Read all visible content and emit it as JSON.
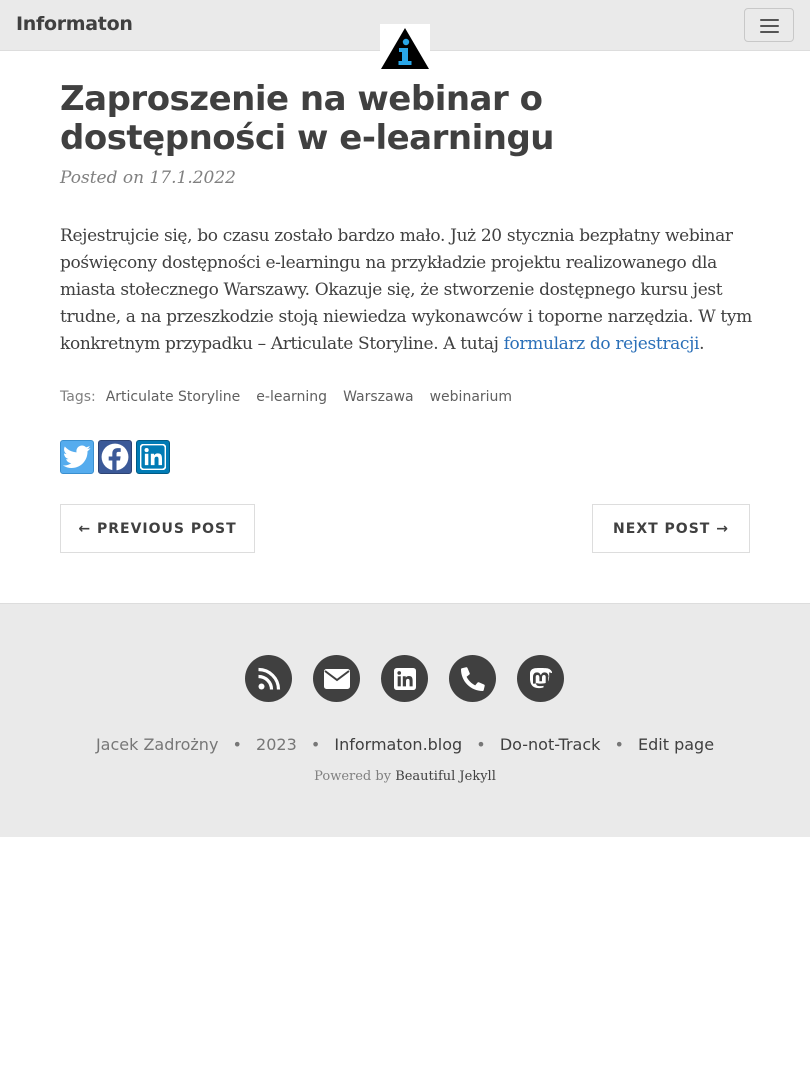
{
  "navbar": {
    "brand": "Informaton",
    "menu_icon": "hamburger-icon",
    "avatar_icon": "info-logo-icon"
  },
  "post": {
    "title": "Zaproszenie na webinar o dostępności w e-learningu",
    "meta": "Posted on 17.1.2022",
    "body_text": "Rejestrujcie się, bo czasu zostało bardzo mało. Już 20 stycznia bezpłatny webinar poświęcony dostępności e-learningu na przykładzie projektu realizowanego dla miasta stołecznego Warszawy. Okazuje się, że stworzenie dostępnego kursu jest trudne, a na przeszkodzie stoją niewiedza wykonawców i toporne narzędzia. W tym konkretnym przypadku – Articulate Storyline. A tutaj ",
    "body_link": "formularz do rejestracji",
    "body_end": ".",
    "tags_label": "Tags:",
    "tags": [
      "Articulate Storyline",
      "e-learning",
      "Warszawa",
      "webinarium"
    ]
  },
  "share": {
    "items": [
      {
        "icon": "twitter-icon"
      },
      {
        "icon": "facebook-icon"
      },
      {
        "icon": "linkedin-icon"
      }
    ]
  },
  "pager": {
    "previous": "← PREVIOUS POST",
    "next": "NEXT POST →"
  },
  "footer": {
    "social_icons": [
      "rss-icon",
      "envelope-icon",
      "linkedin-icon",
      "phone-icon",
      "mastodon-icon"
    ],
    "author": "Jacek Zadrożny",
    "year": "2023",
    "site": "Informaton.blog",
    "dnt": "Do-not-Track",
    "edit": "Edit page",
    "powered_prefix": "Powered by",
    "powered_link": "Beautiful Jekyll",
    "separator": "•"
  },
  "colors": {
    "navbar_bg": "#eaeaea",
    "footer_bg": "#eaeaea",
    "link": "#2a6fb8",
    "twitter": "#55acee",
    "facebook": "#3b5998",
    "linkedin": "#007bb5",
    "social_circle": "#404040"
  }
}
